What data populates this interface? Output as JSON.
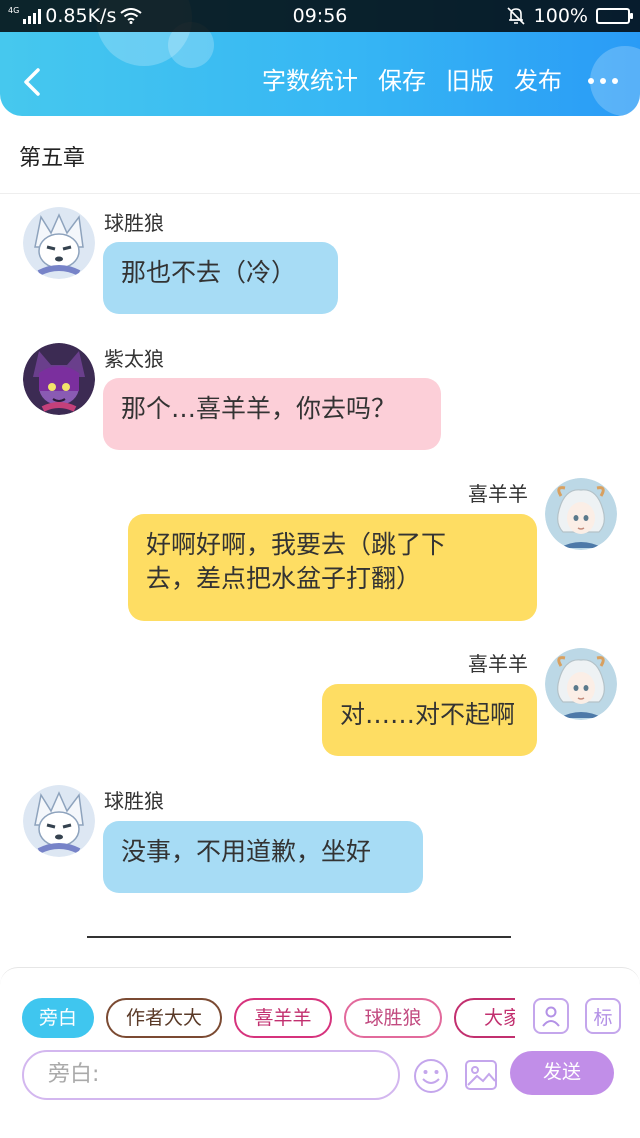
{
  "status_bar": {
    "network": "4G",
    "speed": "0.85K/s",
    "time": "09:56",
    "battery": "100%"
  },
  "toolbar": {
    "items": [
      "字数统计",
      "保存",
      "旧版",
      "发布"
    ]
  },
  "chapter": {
    "title": "第五章"
  },
  "messages": [
    {
      "speaker": "球胜狼",
      "text": "那也不去（冷）",
      "side": "left",
      "bubble_color": "#a7dcf5"
    },
    {
      "speaker": "紫太狼",
      "text": "那个…喜羊羊，你去吗？",
      "side": "left",
      "bubble_color": "#fccfd8"
    },
    {
      "speaker": "喜羊羊",
      "text_lines": [
        "好啊好啊，我要去（跳了下",
        "去，差点把水盆子打翻）"
      ],
      "side": "right",
      "bubble_color": "#fedd63"
    },
    {
      "speaker": "喜羊羊",
      "text": "对……对不起啊",
      "side": "right",
      "bubble_color": "#fedd63"
    },
    {
      "speaker": "球胜狼",
      "text": "没事，不用道歉，坐好",
      "side": "left",
      "bubble_color": "#a7dcf5"
    }
  ],
  "bottom": {
    "chips": [
      "旁白",
      "作者大大",
      "喜羊羊",
      "球胜狼",
      "大家"
    ],
    "side_icons": [
      "person-card-icon",
      "标"
    ],
    "input_placeholder": "旁白:",
    "send_label": "发送"
  },
  "colors": {
    "header_accent": "#36b6f4",
    "active_chip": "#3fc6ef",
    "send_button": "#c18ee8"
  }
}
